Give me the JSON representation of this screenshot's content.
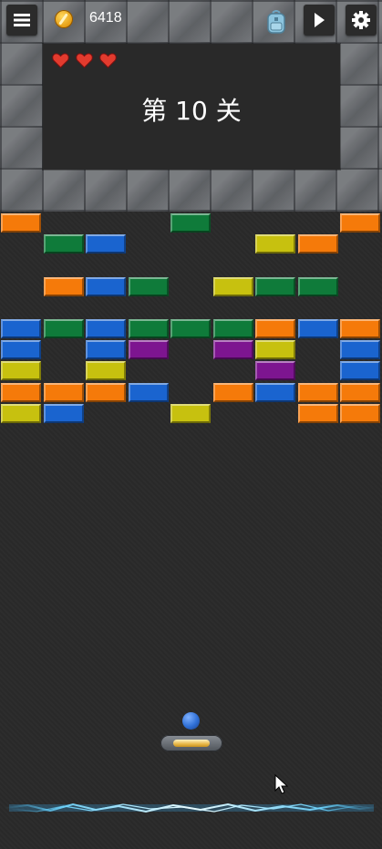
{
  "hud": {
    "menu_icon": "hamburger-menu-icon",
    "coin_icon": "gold-coin-icon",
    "coins": "6418",
    "backpack_icon": "backpack-icon",
    "play_icon": "play-icon",
    "settings_icon": "gear-icon"
  },
  "level_panel": {
    "title": "第 10 关",
    "lives": 3,
    "life_icon": "heart-icon"
  },
  "colors": {
    "orange": "#f57a0a",
    "green": "#0f7b3a",
    "blue": "#1a64cf",
    "yellow": "#c7c10f",
    "purple": "#7d1590",
    "heart": "#e23b2e",
    "background": "#2a2a2a"
  },
  "bricks": [
    {
      "row": 0,
      "col": 0,
      "color": "orange"
    },
    {
      "row": 0,
      "col": 4,
      "color": "green"
    },
    {
      "row": 0,
      "col": 8,
      "color": "orange"
    },
    {
      "row": 1,
      "col": 1,
      "color": "green"
    },
    {
      "row": 1,
      "col": 2,
      "color": "blue"
    },
    {
      "row": 1,
      "col": 6,
      "color": "yellow"
    },
    {
      "row": 1,
      "col": 7,
      "color": "orange"
    },
    {
      "row": 3,
      "col": 1,
      "color": "orange"
    },
    {
      "row": 3,
      "col": 2,
      "color": "blue"
    },
    {
      "row": 3,
      "col": 3,
      "color": "green"
    },
    {
      "row": 3,
      "col": 5,
      "color": "yellow"
    },
    {
      "row": 3,
      "col": 6,
      "color": "green"
    },
    {
      "row": 3,
      "col": 7,
      "color": "green"
    },
    {
      "row": 5,
      "col": 0,
      "color": "blue"
    },
    {
      "row": 5,
      "col": 1,
      "color": "green"
    },
    {
      "row": 5,
      "col": 2,
      "color": "blue"
    },
    {
      "row": 5,
      "col": 3,
      "color": "green"
    },
    {
      "row": 5,
      "col": 4,
      "color": "green"
    },
    {
      "row": 5,
      "col": 5,
      "color": "green"
    },
    {
      "row": 5,
      "col": 6,
      "color": "orange"
    },
    {
      "row": 5,
      "col": 7,
      "color": "blue"
    },
    {
      "row": 5,
      "col": 8,
      "color": "orange"
    },
    {
      "row": 6,
      "col": 0,
      "color": "blue"
    },
    {
      "row": 6,
      "col": 2,
      "color": "blue"
    },
    {
      "row": 6,
      "col": 3,
      "color": "purple"
    },
    {
      "row": 6,
      "col": 5,
      "color": "purple"
    },
    {
      "row": 6,
      "col": 6,
      "color": "yellow"
    },
    {
      "row": 6,
      "col": 8,
      "color": "blue"
    },
    {
      "row": 7,
      "col": 0,
      "color": "yellow"
    },
    {
      "row": 7,
      "col": 2,
      "color": "yellow"
    },
    {
      "row": 7,
      "col": 6,
      "color": "purple"
    },
    {
      "row": 7,
      "col": 8,
      "color": "blue"
    },
    {
      "row": 8,
      "col": 0,
      "color": "orange"
    },
    {
      "row": 8,
      "col": 1,
      "color": "orange"
    },
    {
      "row": 8,
      "col": 2,
      "color": "orange"
    },
    {
      "row": 8,
      "col": 3,
      "color": "blue"
    },
    {
      "row": 8,
      "col": 5,
      "color": "orange"
    },
    {
      "row": 8,
      "col": 6,
      "color": "blue"
    },
    {
      "row": 8,
      "col": 7,
      "color": "orange"
    },
    {
      "row": 8,
      "col": 8,
      "color": "orange"
    },
    {
      "row": 9,
      "col": 0,
      "color": "yellow"
    },
    {
      "row": 9,
      "col": 1,
      "color": "blue"
    },
    {
      "row": 9,
      "col": 4,
      "color": "yellow"
    },
    {
      "row": 9,
      "col": 7,
      "color": "orange"
    },
    {
      "row": 9,
      "col": 8,
      "color": "orange"
    }
  ],
  "ball_icon": "ball",
  "paddle_icon": "paddle",
  "cursor_icon": "mouse-cursor-icon",
  "floor_icon": "electric-barrier"
}
